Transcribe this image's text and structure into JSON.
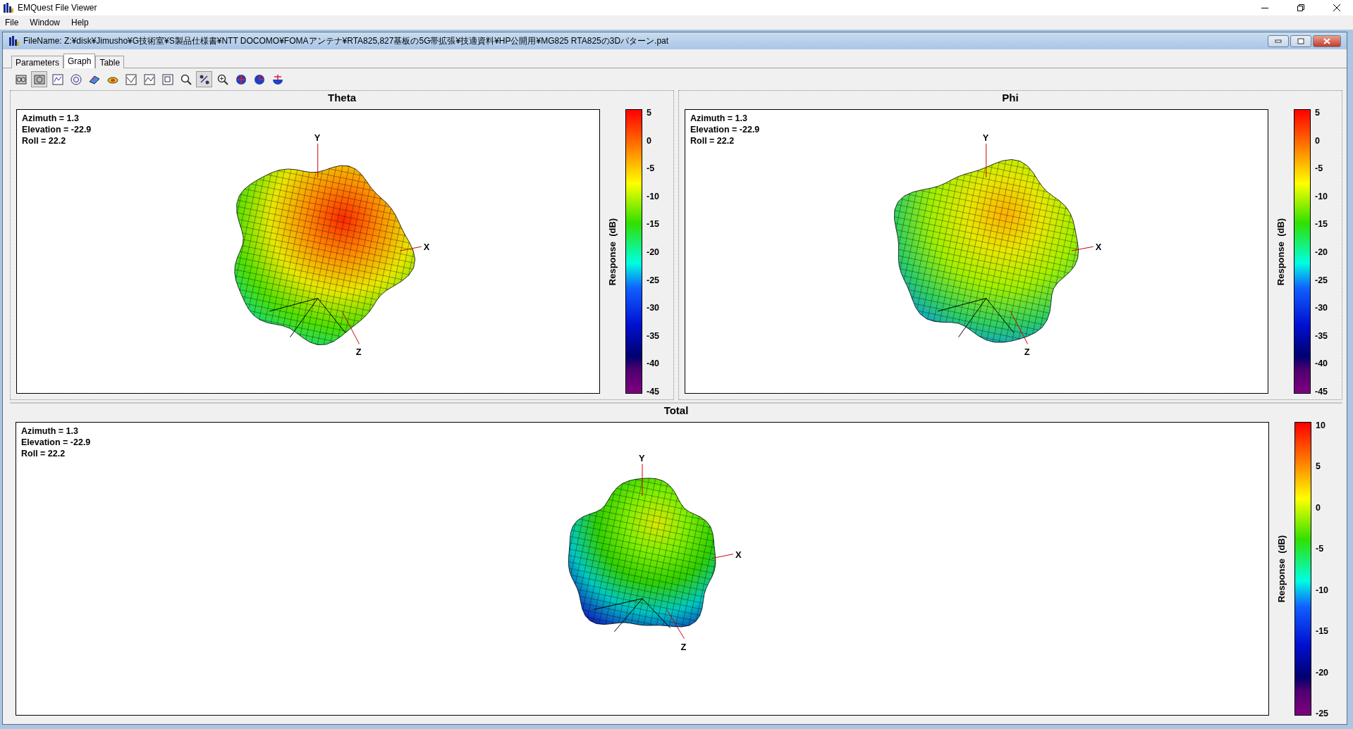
{
  "window": {
    "title": "EMQuest File Viewer"
  },
  "menu": [
    "File",
    "Window",
    "Help"
  ],
  "document": {
    "title": "FileName:  Z:¥disk¥Jimusho¥G技術室¥S製品仕様書¥NTT DOCOMO¥FOMAアンテナ¥RTA825,827基板の5G帯拡張¥技適資料¥HP公開用¥MG825 RTA825の3Dパターン.pat"
  },
  "tabs": [
    {
      "label": "Parameters",
      "selected": false
    },
    {
      "label": "Graph",
      "selected": true
    },
    {
      "label": "Table",
      "selected": false
    }
  ],
  "toolbar": [
    {
      "pressed": false
    },
    {
      "pressed": true
    },
    {
      "pressed": false
    },
    {
      "pressed": false
    },
    {
      "pressed": false
    },
    {
      "pressed": false
    },
    {
      "pressed": false
    },
    {
      "pressed": false
    },
    {
      "pressed": false
    },
    {
      "pressed": false
    },
    {
      "pressed": true
    },
    {
      "pressed": false
    },
    {
      "pressed": false
    },
    {
      "pressed": false
    },
    {
      "pressed": false
    }
  ],
  "plots": [
    {
      "title": "Theta",
      "view": [
        "Azimuth = 1.3",
        "Elevation = -22.9",
        "Roll = 22.2"
      ],
      "axes": [
        "Y",
        "X",
        "Z"
      ],
      "colorbar": {
        "label": "Response  (dB)",
        "ticks": [
          "5",
          "0",
          "-5",
          "-10",
          "-15",
          "-20",
          "-25",
          "-30",
          "-35",
          "-40",
          "-45"
        ]
      }
    },
    {
      "title": "Phi",
      "view": [
        "Azimuth = 1.3",
        "Elevation = -22.9",
        "Roll = 22.2"
      ],
      "axes": [
        "Y",
        "X",
        "Z"
      ],
      "colorbar": {
        "label": "Response  (dB)",
        "ticks": [
          "5",
          "0",
          "-5",
          "-10",
          "-15",
          "-20",
          "-25",
          "-30",
          "-35",
          "-40",
          "-45"
        ]
      }
    },
    {
      "title": "Total",
      "view": [
        "Azimuth = 1.3",
        "Elevation = -22.9",
        "Roll = 22.2"
      ],
      "axes": [
        "Y",
        "X",
        "Z"
      ],
      "colorbar": {
        "label": "Response  (dB)",
        "ticks": [
          "10",
          "5",
          "0",
          "-5",
          "-10",
          "-15",
          "-20",
          "-25"
        ]
      }
    }
  ]
}
